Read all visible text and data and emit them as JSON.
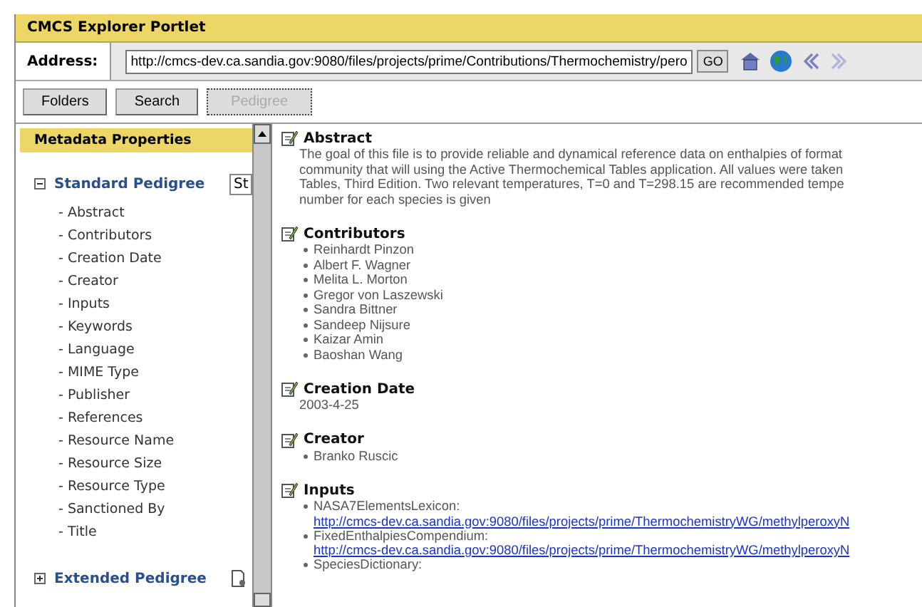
{
  "portlet": {
    "title": "CMCS Explorer Portlet"
  },
  "address": {
    "label": "Address:",
    "value": "http://cmcs-dev.ca.sandia.gov:9080/files/projects/prime/Contributions/Thermochemistry/pero",
    "go": "GO"
  },
  "nav_buttons": [
    {
      "label": "Folders",
      "selected": false
    },
    {
      "label": "Search",
      "selected": false
    },
    {
      "label": "Pedigree",
      "selected": true
    }
  ],
  "sidebar": {
    "title": "Metadata Properties",
    "groups": [
      {
        "label": "Standard Pedigree",
        "expanded": true,
        "select_value": "St",
        "children": [
          "- Abstract",
          "- Contributors",
          "- Creation Date",
          "- Creator",
          "- Inputs",
          "- Keywords",
          "- Language",
          "- MIME Type",
          "- Publisher",
          "- References",
          "- Resource Name",
          "- Resource Size",
          "- Resource Type",
          "- Sanctioned By",
          "- Title"
        ]
      },
      {
        "label": "Extended Pedigree",
        "expanded": false
      }
    ]
  },
  "sections": [
    {
      "kind": "paragraph",
      "title": "Abstract",
      "lines": [
        "The goal of this file is to provide reliable and dynamical reference data on enthalpies of format",
        "community that will using the Active Thermochemical Tables application. All values were taken",
        "Tables, Third Edition. Two relevant temperatures, T=0 and T=298.15 are recommended tempe",
        "number for each species is given"
      ]
    },
    {
      "kind": "list",
      "title": "Contributors",
      "items": [
        "Reinhardt Pinzon",
        "Albert F. Wagner",
        "Melita L. Morton",
        "Gregor von Laszewski",
        "Sandra Bittner",
        "Sandeep Nijsure",
        "Kaizar Amin",
        "Baoshan Wang"
      ]
    },
    {
      "kind": "paragraph",
      "title": "Creation Date",
      "lines": [
        "2003-4-25"
      ]
    },
    {
      "kind": "list",
      "title": "Creator",
      "items": [
        "Branko Ruscic"
      ]
    },
    {
      "kind": "links",
      "title": "Inputs",
      "links": [
        {
          "name": "NASA7ElementsLexicon:",
          "url": "http://cmcs-dev.ca.sandia.gov:9080/files/projects/prime/ThermochemistryWG/methylperoxyN"
        },
        {
          "name": "FixedEnthalpiesCompendium:",
          "url": "http://cmcs-dev.ca.sandia.gov:9080/files/projects/prime/ThermochemistryWG/methylperoxyN"
        },
        {
          "name": "SpeciesDictionary:"
        }
      ]
    }
  ]
}
